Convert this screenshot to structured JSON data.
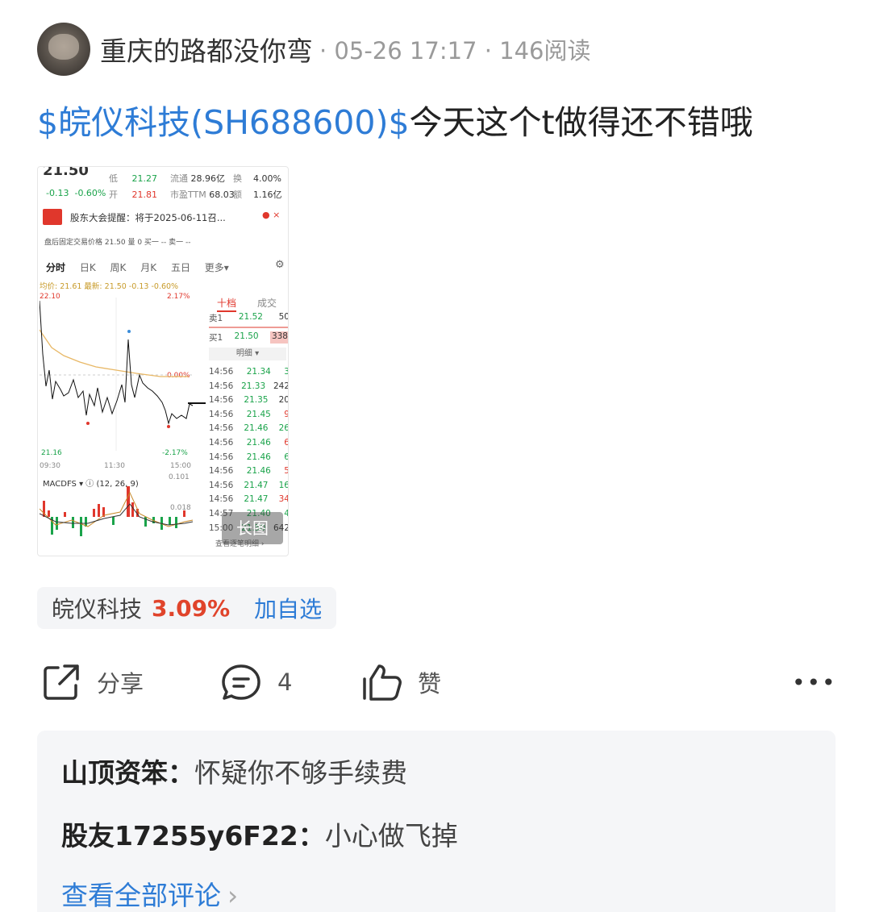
{
  "post": {
    "author": "重庆的路都没你弯",
    "meta": "· 05-26 17:17 · 146阅读",
    "stock_tag": "$皖仪科技(SH688600)$",
    "text": "今天这个t做得还不错哦"
  },
  "screenshot": {
    "price_top": "21.50",
    "change": "-0.13",
    "change_pct": "-0.60%",
    "low_label": "低",
    "low_value": "21.27",
    "open_label": "开",
    "open_value": "21.81",
    "float_label": "流通",
    "float_value": "28.96亿",
    "pe_label": "市盈TTM",
    "pe_value": "68.03",
    "turnover_label": "换",
    "turnover_value": "4.00%",
    "amount_label": "额",
    "amount_value": "1.16亿",
    "notice": "股东大会提醒：将于2025-06-11召...",
    "after_hours": "盘后固定交易价格 21.50  量 0  买一 --  卖一 --",
    "tabs": [
      "分时",
      "日K",
      "周K",
      "月K",
      "五日",
      "更多▾"
    ],
    "avg_line": "均价: 21.61  最新: 21.50  -0.13  -0.60%",
    "y_high": "22.10",
    "y_high_pct": "2.17%",
    "y_low": "21.16",
    "y_low_pct": "-2.17%",
    "mid_pct": "0.00%",
    "times": [
      "09:30",
      "11:30",
      "15:00"
    ],
    "macd_label": "MACDFS ▾  ⓘ (12, 26, 9)",
    "macd_top": "0.101",
    "macd_mid": "0.018",
    "ob_tabs": [
      "十档",
      "成交"
    ],
    "sell1": {
      "label": "卖1",
      "price": "21.52",
      "vol": "50"
    },
    "buy1": {
      "label": "买1",
      "price": "21.50",
      "vol": "338"
    },
    "detail_label": "明细 ▾",
    "trades": [
      {
        "t": "14:56",
        "p": "21.34",
        "v": "3"
      },
      {
        "t": "14:56",
        "p": "21.33",
        "v": "242"
      },
      {
        "t": "14:56",
        "p": "21.35",
        "v": "20"
      },
      {
        "t": "14:56",
        "p": "21.45",
        "v": "9"
      },
      {
        "t": "14:56",
        "p": "21.46",
        "v": "26"
      },
      {
        "t": "14:56",
        "p": "21.46",
        "v": "6"
      },
      {
        "t": "14:56",
        "p": "21.46",
        "v": "6"
      },
      {
        "t": "14:56",
        "p": "21.46",
        "v": "5"
      },
      {
        "t": "14:56",
        "p": "21.47",
        "v": "16"
      },
      {
        "t": "14:56",
        "p": "21.47",
        "v": "34"
      },
      {
        "t": "14:57",
        "p": "21.40",
        "v": "4"
      },
      {
        "t": "15:00",
        "p": "21.50",
        "v": "642"
      }
    ],
    "view_detail": "查看逐笔明细 ›",
    "long_image": "长图"
  },
  "stock_chip": {
    "name": "皖仪科技",
    "pct": "3.09%",
    "add": "加自选"
  },
  "actions": {
    "share": "分享",
    "comments": "4",
    "like": "赞"
  },
  "comments": [
    {
      "user": "山顶资笨：",
      "text": "怀疑你不够手续费"
    },
    {
      "user": "股友17255y6F22：",
      "text": "小心做飞掉"
    }
  ],
  "view_all": "查看全部评论",
  "colors": {
    "link": "#2e7cd6",
    "up": "#e0442b",
    "green": "#1aa34a"
  }
}
